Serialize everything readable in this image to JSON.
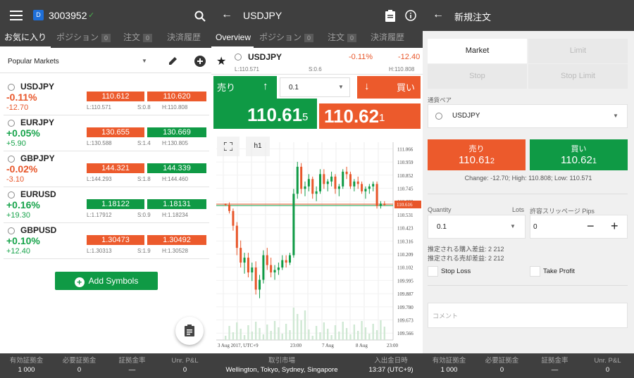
{
  "left": {
    "account_id": "3003952",
    "tabs": [
      {
        "label": "お気に入り"
      },
      {
        "label": "ポジション",
        "count": "0"
      },
      {
        "label": "注文",
        "count": "0"
      },
      {
        "label": "決済履歴"
      }
    ],
    "watchlist_title": "Popular Markets",
    "rows": [
      {
        "symbol": "USDJPY",
        "pct": "-0.11%",
        "chg": "-12.70",
        "bid": "110.612",
        "ask": "110.620",
        "low": "L:110.571",
        "spread": "S:0.8",
        "high": "H:110.808",
        "dir": "down"
      },
      {
        "symbol": "EURJPY",
        "pct": "+0.05%",
        "chg": "+5.90",
        "bid": "130.655",
        "ask": "130.669",
        "low": "L:130.588",
        "spread": "S:1.4",
        "high": "H:130.805",
        "dir": "up"
      },
      {
        "symbol": "GBPJPY",
        "pct": "-0.02%",
        "chg": "-3.10",
        "bid": "144.321",
        "ask": "144.339",
        "low": "L:144.293",
        "spread": "S:1.8",
        "high": "H:144.460",
        "dir": "down"
      },
      {
        "symbol": "EURUSD",
        "pct": "+0.16%",
        "chg": "+19.30",
        "bid": "1.18122",
        "ask": "1.18131",
        "low": "L:1.17912",
        "spread": "S:0.9",
        "high": "H:1.18234",
        "dir": "up"
      },
      {
        "symbol": "GBPUSD",
        "pct": "+0.10%",
        "chg": "+12.40",
        "bid": "1.30473",
        "ask": "1.30492",
        "low": "L:1.30313",
        "spread": "S:1.9",
        "high": "H:1.30528",
        "dir": "up"
      }
    ],
    "add_symbols": "Add Symbols",
    "bottom": [
      {
        "label": "有効証拠金",
        "value": "1 000"
      },
      {
        "label": "必要証拠金",
        "value": "0"
      },
      {
        "label": "証拠金率",
        "value": "—"
      },
      {
        "label": "Unr. P&L",
        "value": "0"
      }
    ]
  },
  "middle": {
    "title": "USDJPY",
    "tabs": [
      {
        "label": "Overview"
      },
      {
        "label": "ポジション",
        "count": "0"
      },
      {
        "label": "注文",
        "count": "0"
      },
      {
        "label": "決済履歴"
      }
    ],
    "symbol": "USDJPY",
    "pct": "-0.11%",
    "chg": "-12.40",
    "low": "L:110.571",
    "spread": "S:0.6",
    "high": "H:110.808",
    "sell_label": "売り",
    "buy_label": "買い",
    "quantity": "0.1",
    "sell_main": "110.61",
    "sell_pip": "5",
    "buy_main": "110.62",
    "buy_pip": "1",
    "timeframe": "h1",
    "bottom": [
      {
        "label": "取引市場",
        "value": "Wellington, Tokyo, Sydney, Singapore"
      },
      {
        "label": "入出金日時",
        "value": "13:37 (UTC+9)"
      }
    ]
  },
  "right": {
    "title": "新規注文",
    "order_types": [
      "Market",
      "Limit",
      "Stop",
      "Stop Limit"
    ],
    "pair_label": "通貨ペア",
    "pair_value": "USDJPY",
    "sell_label": "売り",
    "sell_main": "110.61",
    "sell_pip": "2",
    "buy_label": "買い",
    "buy_main": "110.62",
    "buy_pip": "1",
    "summary": "Change: -12.70; High: 110.808; Low: 110.571",
    "quantity_label": "Quantity",
    "lots_label": "Lots",
    "quantity_value": "0.1",
    "slippage_label": "許容スリッページ Pips",
    "slippage_value": "0",
    "buy_margin": "推定される購入差益: 2 212",
    "sell_margin": "推定される売却差益: 2 212",
    "stop_loss": "Stop Loss",
    "take_profit": "Take Profit",
    "comment_placeholder": "コメント",
    "bottom": [
      {
        "label": "有効証拠金",
        "value": "1 000"
      },
      {
        "label": "必要証拠金",
        "value": "0"
      },
      {
        "label": "証拠金率",
        "value": "—"
      },
      {
        "label": "Unr. P&L",
        "value": "0"
      }
    ]
  },
  "chart_data": {
    "type": "candlestick",
    "y_ticks": [
      "111.066",
      "110.959",
      "110.852",
      "110.745",
      "110.638",
      "110.531",
      "110.423",
      "110.316",
      "110.209",
      "110.102",
      "109.995",
      "109.887",
      "109.780",
      "109.673",
      "109.566"
    ],
    "x_ticks": [
      "3 Aug 2017, UTC+9",
      "23:00",
      "7 Aug",
      "8 Aug",
      "23:00"
    ],
    "current_price": "110.616",
    "ylim": [
      109.51,
      111.12
    ],
    "candles": [
      [
        110.62,
        110.62,
        110.6,
        110.61
      ],
      [
        110.61,
        110.63,
        110.54,
        110.56
      ],
      [
        110.56,
        110.58,
        110.4,
        110.44
      ],
      [
        110.44,
        110.47,
        110.2,
        110.26
      ],
      [
        110.26,
        110.32,
        110.1,
        110.14
      ],
      [
        110.14,
        110.22,
        110.05,
        110.18
      ],
      [
        110.18,
        110.22,
        110.02,
        110.06
      ],
      [
        110.06,
        110.14,
        109.99,
        110.1
      ],
      [
        110.1,
        110.15,
        109.88,
        109.92
      ],
      [
        109.92,
        110.04,
        109.85,
        110.0
      ],
      [
        110.0,
        110.24,
        109.97,
        110.2
      ],
      [
        110.2,
        110.26,
        110.08,
        110.12
      ],
      [
        110.12,
        110.18,
        110.02,
        110.06
      ],
      [
        110.06,
        110.12,
        110.0,
        110.08
      ],
      [
        110.08,
        110.14,
        110.04,
        110.1
      ],
      [
        110.1,
        110.2,
        110.08,
        110.16
      ],
      [
        110.16,
        110.2,
        110.1,
        110.14
      ],
      [
        110.14,
        110.22,
        110.12,
        110.2
      ],
      [
        110.2,
        110.74,
        110.18,
        110.7
      ],
      [
        110.7,
        110.96,
        110.66,
        110.92
      ],
      [
        110.92,
        110.95,
        110.7,
        110.74
      ],
      [
        110.74,
        110.8,
        110.68,
        110.76
      ],
      [
        110.76,
        110.86,
        110.72,
        110.82
      ],
      [
        110.82,
        110.84,
        110.66,
        110.7
      ],
      [
        110.7,
        110.76,
        110.64,
        110.72
      ],
      [
        110.72,
        110.9,
        110.7,
        110.86
      ],
      [
        110.86,
        110.9,
        110.74,
        110.78
      ],
      [
        110.78,
        110.82,
        110.72,
        110.8
      ],
      [
        110.8,
        110.88,
        110.76,
        110.84
      ],
      [
        110.84,
        110.86,
        110.7,
        110.74
      ],
      [
        110.74,
        110.78,
        110.68,
        110.76
      ],
      [
        110.76,
        110.9,
        110.74,
        110.88
      ],
      [
        110.88,
        110.92,
        110.82,
        110.86
      ],
      [
        110.86,
        110.88,
        110.74,
        110.76
      ],
      [
        110.76,
        110.82,
        110.72,
        110.8
      ],
      [
        110.8,
        110.84,
        110.74,
        110.78
      ],
      [
        110.78,
        110.8,
        110.7,
        110.72
      ],
      [
        110.72,
        110.76,
        110.66,
        110.74
      ],
      [
        110.74,
        110.78,
        110.7,
        110.76
      ],
      [
        110.76,
        110.8,
        110.72,
        110.78
      ],
      [
        110.78,
        110.8,
        110.58,
        110.6
      ],
      [
        110.6,
        110.64,
        110.58,
        110.62
      ],
      [
        110.62,
        110.64,
        110.6,
        110.61
      ]
    ]
  }
}
